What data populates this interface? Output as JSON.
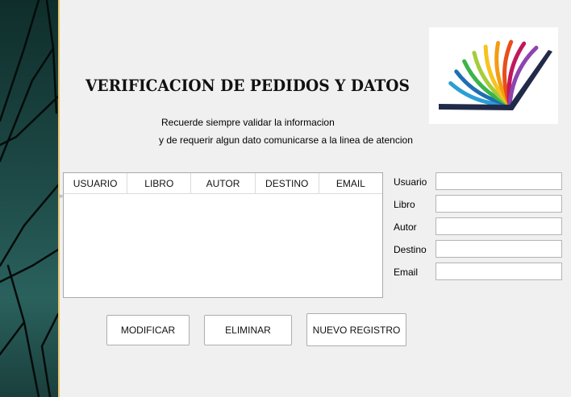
{
  "header": {
    "title": "VERIFICACION DE PEDIDOS Y DATOS",
    "note_line1": "Recuerde siempre validar la informacion",
    "note_line2": "y de requerir algun dato comunicarse a la linea de atencion"
  },
  "logo": {
    "icon": "book-fan-logo",
    "colors": [
      "#2a9fd6",
      "#1f6fb2",
      "#3bb44a",
      "#a5cd39",
      "#f7c320",
      "#f39c12",
      "#e94e1b",
      "#c2185b",
      "#8e44ad",
      "#222a4a"
    ]
  },
  "table": {
    "columns": [
      "USUARIO",
      "LIBRO",
      "AUTOR",
      "DESTINO",
      "EMAIL"
    ],
    "rows": []
  },
  "form": {
    "fields": [
      {
        "label": "Usuario",
        "value": ""
      },
      {
        "label": "Libro",
        "value": ""
      },
      {
        "label": "Autor",
        "value": ""
      },
      {
        "label": "Destino",
        "value": ""
      },
      {
        "label": "Email",
        "value": ""
      }
    ]
  },
  "buttons": {
    "modify": "MODIFICAR",
    "delete": "ELIMINAR",
    "new_record": "NUEVO REGISTRO"
  },
  "colors": {
    "background": "#f0f0f0",
    "side_panel": "#1d4946",
    "side_border": "#e9c46a"
  }
}
